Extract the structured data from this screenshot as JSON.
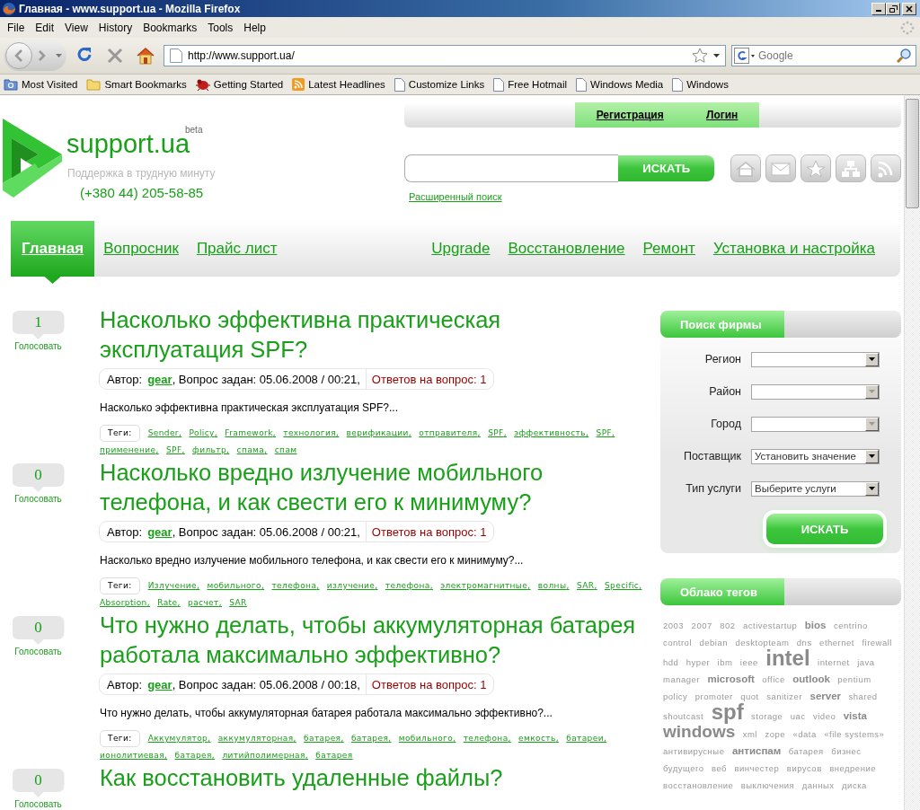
{
  "window": {
    "title": "Главная - www.support.ua - Mozilla Firefox"
  },
  "menu": [
    "File",
    "Edit",
    "View",
    "History",
    "Bookmarks",
    "Tools",
    "Help"
  ],
  "toolbar": {
    "url": "http://www.support.ua/",
    "search_placeholder": "Google"
  },
  "bookmarks": [
    {
      "label": "Most Visited",
      "kind": "smart"
    },
    {
      "label": "Smart Bookmarks",
      "kind": "folder"
    },
    {
      "label": "Getting Started",
      "kind": "bug"
    },
    {
      "label": "Latest Headlines",
      "kind": "feed"
    },
    {
      "label": "Customize Links",
      "kind": "page"
    },
    {
      "label": "Free Hotmail",
      "kind": "page"
    },
    {
      "label": "Windows Media",
      "kind": "page"
    },
    {
      "label": "Windows",
      "kind": "page"
    }
  ],
  "site": {
    "logo": "support.ua",
    "beta": "beta",
    "tagline": "Поддержка в трудную минуту",
    "phone": "(+380 44) 205-58-85"
  },
  "account_links": [
    "Регистрация",
    "Логин"
  ],
  "search": {
    "button": "ИСКАТЬ",
    "advanced": "Расширенный поиск"
  },
  "nav": {
    "left": [
      {
        "label": "Главная",
        "selected": true
      },
      {
        "label": "Вопросник",
        "selected": false
      },
      {
        "label": "Прайс лист",
        "selected": false
      }
    ],
    "right": [
      {
        "label": "Upgrade",
        "selected": false
      },
      {
        "label": "Восстановление",
        "selected": false
      },
      {
        "label": "Ремонт",
        "selected": false
      },
      {
        "label": "Установка и настройка",
        "selected": false
      }
    ]
  },
  "posts": [
    {
      "votes": "1",
      "vote_label": "Голосовать",
      "title": "Насколько эффективна практическая эксплуатация SPF?",
      "author_label": "Автор:",
      "author": "gear",
      "asked": ", Вопрос задан: 05.06.2008 / 00:21,",
      "answers": "Ответов на вопрос: 1",
      "excerpt": "Насколько эффективна практическая эксплуатация SPF?...",
      "tags_label": "Теги:",
      "separator": ",",
      "tags": [
        "Sender",
        "Policy",
        "Framework",
        "технология",
        "верификации",
        "отправителя",
        "SPF",
        "эффективность",
        "SPF",
        "применение",
        "SPF",
        "фильтр",
        "спама",
        "спам"
      ]
    },
    {
      "votes": "0",
      "vote_label": "Голосовать",
      "title": "Насколько вредно излучение мобильного телефона, и как свести его к минимуму?",
      "author_label": "Автор:",
      "author": "gear",
      "asked": ", Вопрос задан: 05.06.2008 / 00:21,",
      "answers": "Ответов на вопрос: 1",
      "excerpt": "Насколько вредно излучение мобильного телефона, и как свести его к минимуму?...",
      "tags_label": "Теги:",
      "separator": ",",
      "tags": [
        "Излучение",
        "мобильного",
        "телефона",
        "излучение",
        "телефона",
        "электромагнитные",
        "волны",
        "SAR",
        "Specific",
        "Absorption",
        "Rate",
        "расчет",
        "SAR"
      ]
    },
    {
      "votes": "0",
      "vote_label": "Голосовать",
      "title": "Что нужно делать, чтобы аккумуляторная батарея работала максимально эффективно?",
      "author_label": "Автор:",
      "author": "gear",
      "asked": ", Вопрос задан: 05.06.2008 / 00:18,",
      "answers": "Ответов на вопрос: 1",
      "excerpt": "Что нужно делать, чтобы аккумуляторная батарея работала максимально эффективно?...",
      "tags_label": "Теги:",
      "separator": ",",
      "tags": [
        "Аккумулятор",
        "аккумуляторная",
        "батарея",
        "батарея",
        "мобильного",
        "телефона",
        "емкость",
        "батареи",
        "ионолитиевая",
        "батарея",
        "литийполимерная",
        "батарея"
      ]
    },
    {
      "votes": "0",
      "vote_label": "Голосовать",
      "title": "Как восстановить удаленные файлы?"
    }
  ],
  "firm_search": {
    "title": "Поиск фирмы",
    "fields": [
      {
        "label": "Регион",
        "disabled": false
      },
      {
        "label": "Район",
        "disabled": true
      },
      {
        "label": "Город",
        "disabled": true
      },
      {
        "label": "Поставщик",
        "value": "Установить значение",
        "disabled": false
      },
      {
        "label": "Тип услуги",
        "value": "Выберите услуги",
        "disabled": false
      }
    ],
    "button": "ИСКАТЬ"
  },
  "tag_cloud": {
    "title": "Облако тегов",
    "tags": [
      {
        "label": "2003",
        "kind": "small"
      },
      {
        "label": "2007",
        "kind": "small"
      },
      {
        "label": "802",
        "kind": "small"
      },
      {
        "label": "activestartup",
        "kind": "small"
      },
      {
        "label": "bios",
        "kind": "medium"
      },
      {
        "label": "centrino",
        "kind": "small"
      },
      {
        "label": "control",
        "kind": "small"
      },
      {
        "label": "debian",
        "kind": "small"
      },
      {
        "label": "desktopteam",
        "kind": "small"
      },
      {
        "label": "dns",
        "kind": "small"
      },
      {
        "label": "ethernet",
        "kind": "small"
      },
      {
        "label": "firewall",
        "kind": "small"
      },
      {
        "label": "hdd",
        "kind": "small"
      },
      {
        "label": "hyper",
        "kind": "small"
      },
      {
        "label": "ibm",
        "kind": "small"
      },
      {
        "label": "ieee",
        "kind": "small"
      },
      {
        "label": "intel",
        "kind": "huge"
      },
      {
        "label": "internet",
        "kind": "small"
      },
      {
        "label": "java",
        "kind": "small"
      },
      {
        "label": "manager",
        "kind": "small"
      },
      {
        "label": "microsoft",
        "kind": "medium"
      },
      {
        "label": "office",
        "kind": "small"
      },
      {
        "label": "outlook",
        "kind": "medium"
      },
      {
        "label": "pentium",
        "kind": "small"
      },
      {
        "label": "policy",
        "kind": "small"
      },
      {
        "label": "promoter",
        "kind": "small"
      },
      {
        "label": "quot",
        "kind": "small"
      },
      {
        "label": "sanitizer",
        "kind": "small"
      },
      {
        "label": "server",
        "kind": "medium"
      },
      {
        "label": "shared",
        "kind": "small"
      },
      {
        "label": "shoutcast",
        "kind": "small"
      },
      {
        "label": "spf",
        "kind": "huge"
      },
      {
        "label": "storage",
        "kind": "small"
      },
      {
        "label": "uac",
        "kind": "small"
      },
      {
        "label": "video",
        "kind": "small"
      },
      {
        "label": "vista",
        "kind": "medium"
      },
      {
        "label": "windows",
        "kind": "large"
      },
      {
        "label": "xml",
        "kind": "small"
      },
      {
        "label": "zope",
        "kind": "small"
      },
      {
        "label": "«data",
        "kind": "small"
      },
      {
        "label": "«file systems»",
        "kind": "small"
      },
      {
        "label": "антивирусные",
        "kind": "small"
      },
      {
        "label": "антиспам",
        "kind": "medium"
      },
      {
        "label": "батарея",
        "kind": "small"
      },
      {
        "label": "бизнес",
        "kind": "small"
      },
      {
        "label": "будущего",
        "kind": "small"
      },
      {
        "label": "веб",
        "kind": "small"
      },
      {
        "label": "винчестер",
        "kind": "small"
      },
      {
        "label": "вирусов",
        "kind": "small"
      },
      {
        "label": "внедрение",
        "kind": "small"
      },
      {
        "label": "восстановление",
        "kind": "small"
      },
      {
        "label": "выключения",
        "kind": "small"
      },
      {
        "label": "данных",
        "kind": "small"
      },
      {
        "label": "диска",
        "kind": "small"
      }
    ]
  }
}
